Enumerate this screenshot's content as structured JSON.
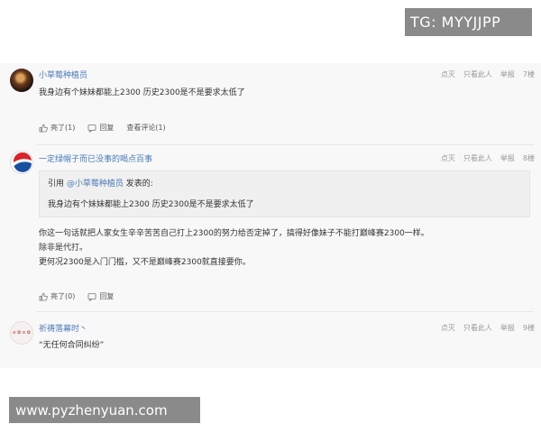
{
  "watermarks": {
    "top": "TG: MYYJJPP",
    "bottom": "www.pyzhenyuan.com"
  },
  "post_actions_labels": {
    "dian_mie": "点灭",
    "only_this_user": "只看此人",
    "report": "举报"
  },
  "posts": [
    {
      "username": "小草莓种植员",
      "floor": "7楼",
      "content": "我身边有个妹妹都能上2300 历史2300是不是要求太低了",
      "like": "亮了(1)",
      "reply": "回复",
      "view_thread": "查看评论(1)"
    },
    {
      "username": "一定绿帽子而已没事的喝点百事",
      "floor": "8楼",
      "quote_prefix": "引用",
      "quote_user": "@小草莓种植员",
      "quote_suffix": "发表的:",
      "quote_text": "我身边有个妹妹都能上2300 历史2300是不是要求太低了",
      "lines": [
        "你这一句话就把人家女生辛辛苦苦自己打上2300的努力给否定掉了，搞得好像妹子不能打巅峰赛2300一样。",
        "除非是代打。",
        "更何况2300是入门门槛，又不是巅峰赛2300就直接要你。"
      ],
      "like": "亮了(0)",
      "reply": "回复"
    },
    {
      "username": "祈祷落幕时丶",
      "floor": "9楼",
      "avatar_text": "ɞ ✿ ɞ ✿",
      "content": "“无任何合同纠纷”"
    }
  ]
}
